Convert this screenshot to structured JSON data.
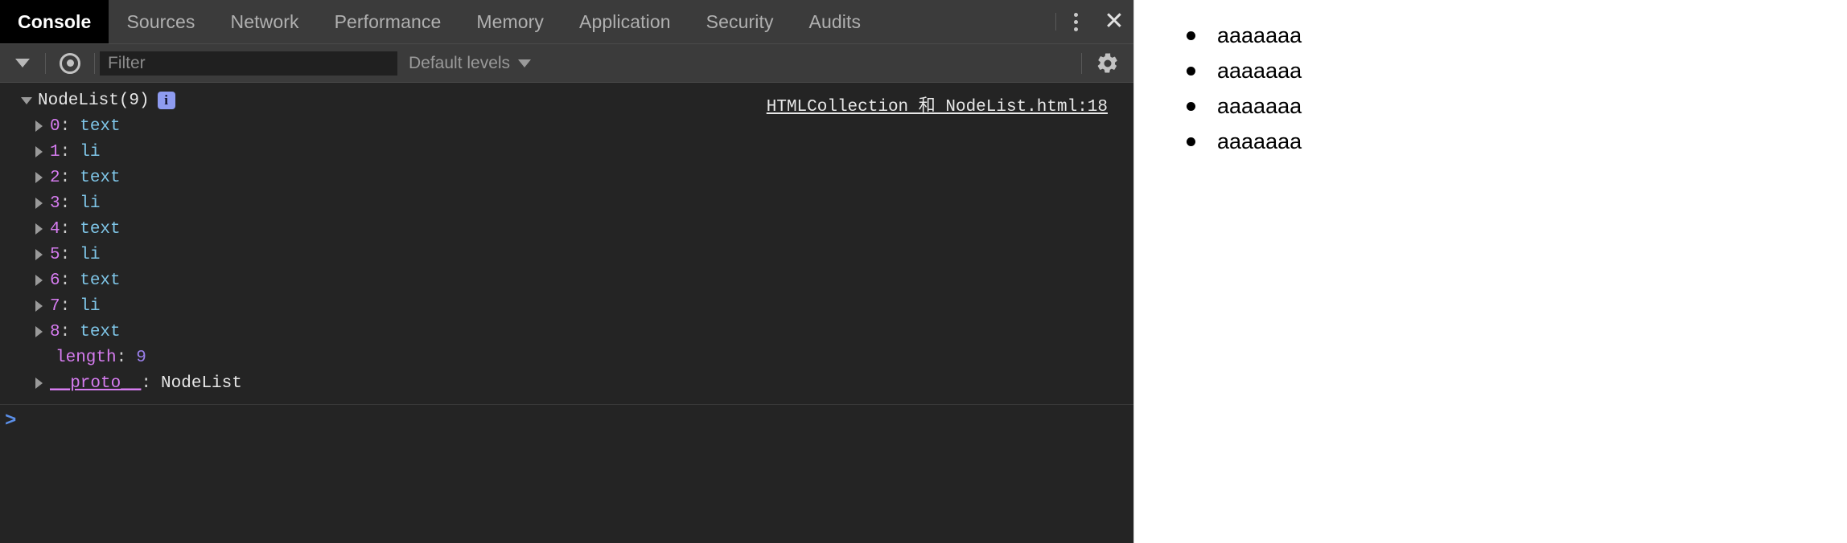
{
  "devtools": {
    "tabs": [
      {
        "label": "Console",
        "active": true
      },
      {
        "label": "Sources",
        "active": false
      },
      {
        "label": "Network",
        "active": false
      },
      {
        "label": "Performance",
        "active": false
      },
      {
        "label": "Memory",
        "active": false
      },
      {
        "label": "Application",
        "active": false
      },
      {
        "label": "Security",
        "active": false
      },
      {
        "label": "Audits",
        "active": false
      }
    ],
    "more_icon": "kebab-menu-icon",
    "close_icon": "close-icon",
    "toolbar": {
      "context_caret_icon": "chevron-down-icon",
      "eye_icon": "eye-icon",
      "filter_placeholder": "Filter",
      "filter_value": "",
      "levels_label": "Default levels",
      "levels_caret_icon": "chevron-down-icon",
      "settings_icon": "gear-icon"
    },
    "console": {
      "source_link": "HTMLCollection 和 NodeList.html:18",
      "header": {
        "title": "NodeList(9)",
        "info_badge": "i",
        "expanded": true
      },
      "entries": [
        {
          "index": "0",
          "value": "text"
        },
        {
          "index": "1",
          "value": "li"
        },
        {
          "index": "2",
          "value": "text"
        },
        {
          "index": "3",
          "value": "li"
        },
        {
          "index": "4",
          "value": "text"
        },
        {
          "index": "5",
          "value": "li"
        },
        {
          "index": "6",
          "value": "text"
        },
        {
          "index": "7",
          "value": "li"
        },
        {
          "index": "8",
          "value": "text"
        }
      ],
      "length_key": "length",
      "length_sep": ":",
      "length_value": "9",
      "proto_key": "__proto__",
      "proto_sep": ":",
      "proto_value": "NodeList",
      "separator": ":",
      "prompt_caret": ">",
      "prompt_value": ""
    }
  },
  "page": {
    "list_items": [
      {
        "text": "aaaaaaa"
      },
      {
        "text": "aaaaaaa"
      },
      {
        "text": "aaaaaaa"
      },
      {
        "text": "aaaaaaa"
      }
    ]
  },
  "colors": {
    "panel_bg": "#242424",
    "toolbar_bg": "#3b3b3b",
    "active_tab_bg": "#000000",
    "key_magenta": "#d67cf0",
    "value_cyan": "#7fc6e8",
    "number_purple": "#9a7fea",
    "prompt_blue": "#5b8fe8",
    "info_badge_blue": "#8e9bf0"
  }
}
